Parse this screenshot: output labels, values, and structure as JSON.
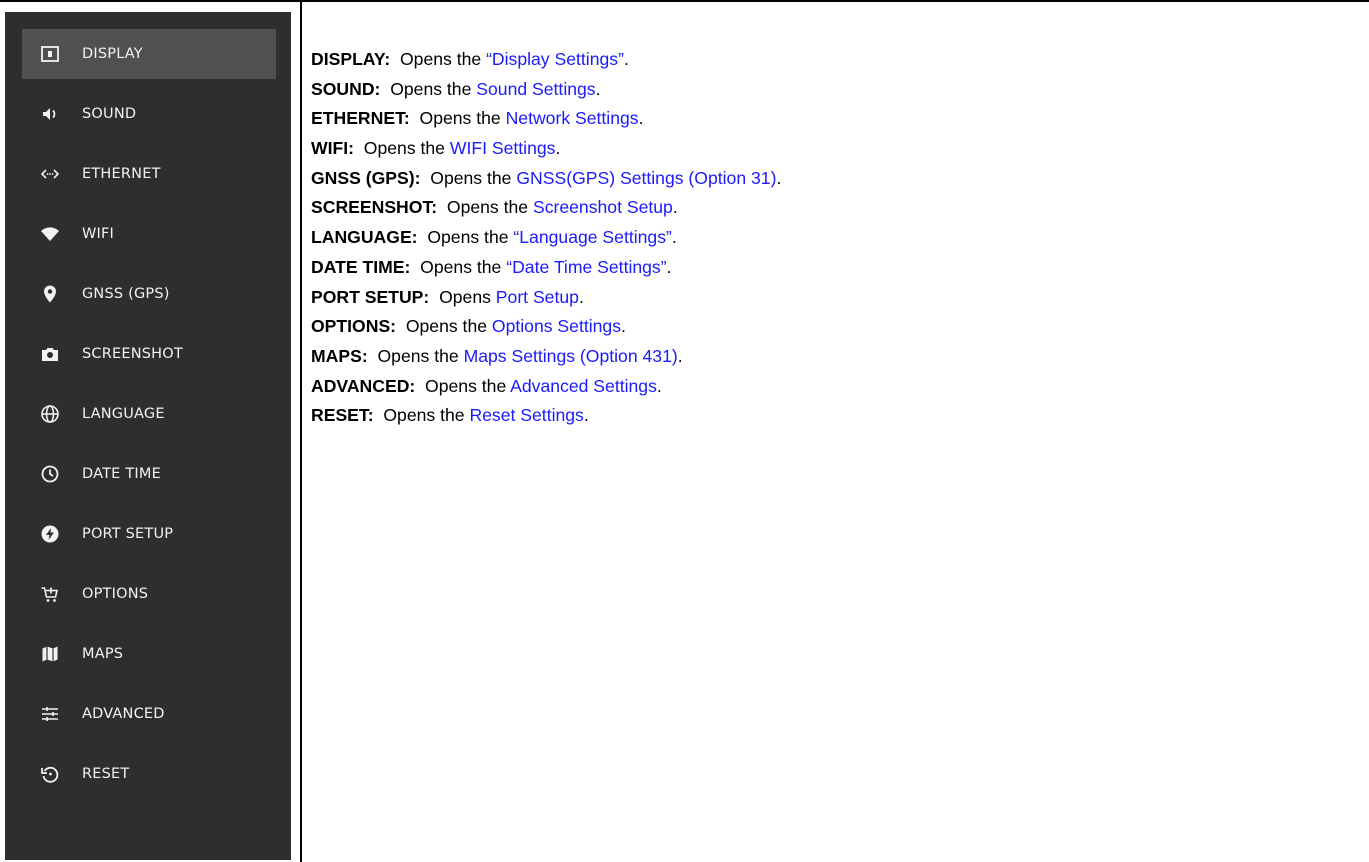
{
  "sidebar": {
    "items": [
      {
        "label": "DISPLAY",
        "icon": "display-icon",
        "selected": true
      },
      {
        "label": "SOUND",
        "icon": "speaker-icon"
      },
      {
        "label": "ETHERNET",
        "icon": "ethernet-icon"
      },
      {
        "label": "WIFI",
        "icon": "wifi-icon"
      },
      {
        "label": "GNSS (GPS)",
        "icon": "location-pin-icon"
      },
      {
        "label": "SCREENSHOT",
        "icon": "camera-icon"
      },
      {
        "label": "LANGUAGE",
        "icon": "globe-icon"
      },
      {
        "label": "DATE TIME",
        "icon": "clock-icon"
      },
      {
        "label": "PORT SETUP",
        "icon": "port-icon"
      },
      {
        "label": "OPTIONS",
        "icon": "cart-add-icon"
      },
      {
        "label": "MAPS",
        "icon": "map-icon"
      },
      {
        "label": "ADVANCED",
        "icon": "sliders-icon"
      },
      {
        "label": "RESET",
        "icon": "reset-icon"
      }
    ]
  },
  "descriptions": [
    {
      "term": "DISPLAY:",
      "text": "Opens the ",
      "link": "“Display Settings”",
      "end": "."
    },
    {
      "term": "SOUND:",
      "text": "Opens the ",
      "link": "Sound Settings",
      "end": "."
    },
    {
      "term": "ETHERNET:",
      "text": "Opens the ",
      "link": "Network Settings",
      "end": "."
    },
    {
      "term": "WIFI:",
      "text": "Opens the ",
      "link": "WIFI Settings",
      "end": "."
    },
    {
      "term": "GNSS (GPS):",
      "text": "Opens the ",
      "link": "GNSS(GPS) Settings (Option 31)",
      "end": "."
    },
    {
      "term": "SCREENSHOT:",
      "text": "Opens the ",
      "link": "Screenshot Setup",
      "end": "."
    },
    {
      "term": "LANGUAGE:",
      "text": "Opens the ",
      "link": "“Language Settings”",
      "end": "."
    },
    {
      "term": "DATE TIME:",
      "text": "Opens the ",
      "link": "“Date Time Settings”",
      "end": "."
    },
    {
      "term": "PORT SETUP:",
      "text": "Opens ",
      "link": "Port Setup",
      "end": "."
    },
    {
      "term": "OPTIONS:",
      "text": "Opens the ",
      "link": "Options Settings",
      "end": "."
    },
    {
      "term": "MAPS:",
      "text": "Opens the ",
      "link": "Maps Settings (Option 431)",
      "end": "."
    },
    {
      "term": "ADVANCED:",
      "text": "Opens the ",
      "link": "Advanced Settings",
      "end": "."
    },
    {
      "term": "RESET:",
      "text": "Opens the ",
      "link": "Reset Settings",
      "end": "."
    }
  ],
  "colors": {
    "sidebar_bg": "#2e2e2e",
    "selected_bg": "#505050",
    "link": "#1a1aff"
  }
}
